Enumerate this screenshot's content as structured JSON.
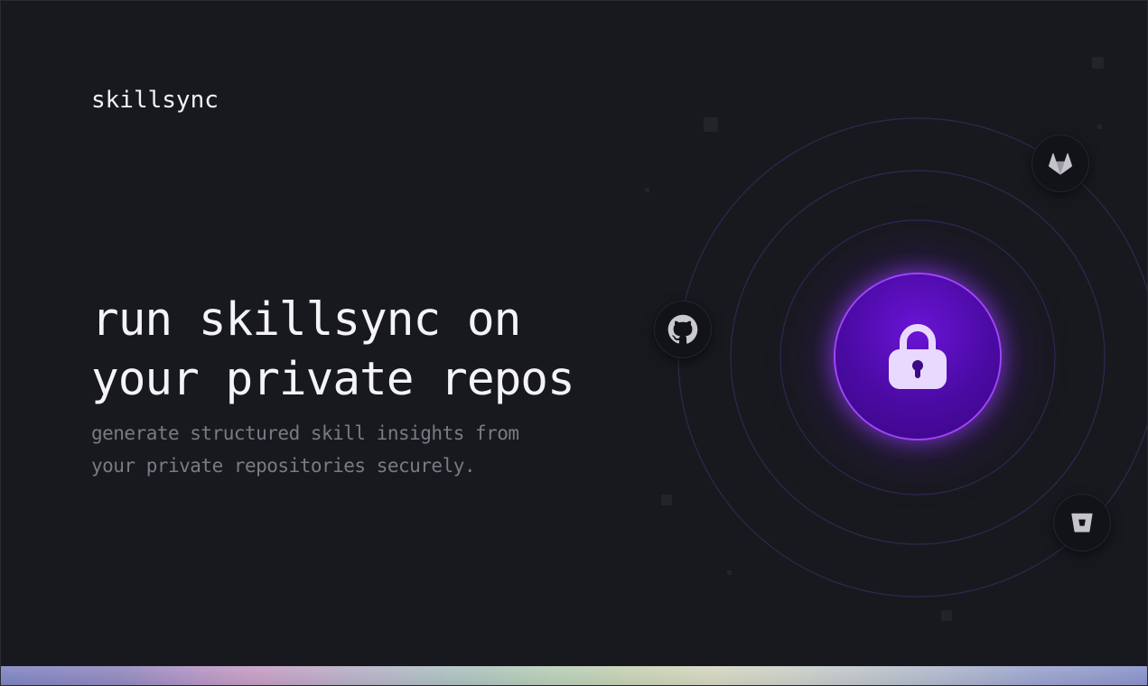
{
  "brand": {
    "name": "skillsync"
  },
  "hero": {
    "headline_line1": "run skillsync on",
    "headline_line2": "your private repos",
    "subline_line1": "generate structured skill insights from",
    "subline_line2": "your private repositories securely."
  },
  "providers": [
    {
      "name": "github",
      "icon": "github-icon"
    },
    {
      "name": "gitlab",
      "icon": "gitlab-icon"
    },
    {
      "name": "bitbucket",
      "icon": "bitbucket-icon"
    }
  ],
  "center_icon": "lock-icon",
  "colors": {
    "background": "#18191e",
    "accent_purple": "#6a14d6",
    "accent_glow": "#a243ff",
    "text_primary": "#f4f4f6",
    "text_muted": "#7a7b82"
  }
}
